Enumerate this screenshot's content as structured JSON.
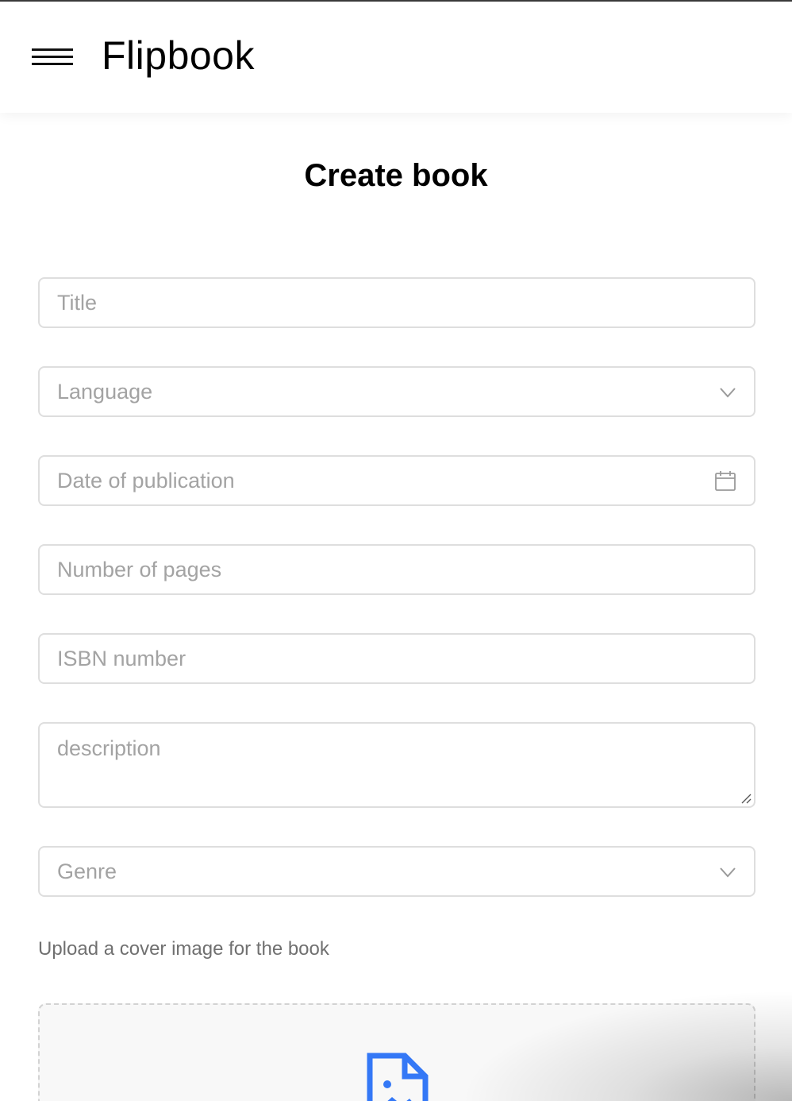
{
  "app": {
    "brand": "Flipbook"
  },
  "page": {
    "title": "Create book"
  },
  "form": {
    "title_placeholder": "Title",
    "language_placeholder": "Language",
    "date_placeholder": "Date of publication",
    "pages_placeholder": "Number of pages",
    "isbn_placeholder": "ISBN number",
    "description_placeholder": "description",
    "genre_placeholder": "Genre",
    "upload_label": "Upload a cover image for the book"
  },
  "icons": {
    "menu": "hamburger-menu-icon",
    "dropdown": "chevron-down-icon",
    "date": "calendar-icon",
    "upload": "file-image-icon"
  },
  "colors": {
    "accent": "#3478f6",
    "border": "#dedede",
    "placeholder": "#a3a3a3"
  }
}
